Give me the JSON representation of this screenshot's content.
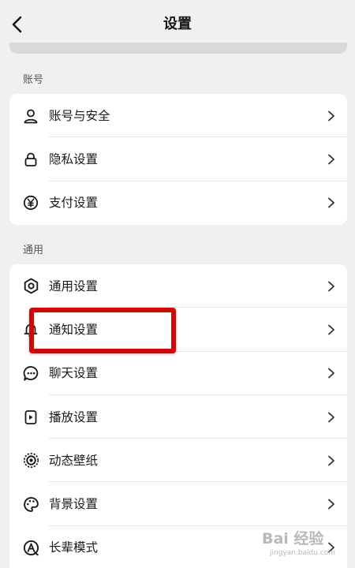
{
  "header": {
    "title": "设置"
  },
  "sections": [
    {
      "label": "账号",
      "items": [
        {
          "label": "账号与安全",
          "icon": "person-icon"
        },
        {
          "label": "隐私设置",
          "icon": "lock-icon"
        },
        {
          "label": "支付设置",
          "icon": "yen-icon"
        }
      ]
    },
    {
      "label": "通用",
      "items": [
        {
          "label": "通用设置",
          "icon": "gear-icon"
        },
        {
          "label": "通知设置",
          "icon": "bell-icon"
        },
        {
          "label": "聊天设置",
          "icon": "chat-bubble-icon"
        },
        {
          "label": "播放设置",
          "icon": "play-device-icon"
        },
        {
          "label": "动态壁纸",
          "icon": "wallpaper-icon"
        },
        {
          "label": "背景设置",
          "icon": "palette-icon"
        },
        {
          "label": "长辈模式",
          "icon": "elder-mode-icon"
        }
      ]
    }
  ],
  "highlight": {
    "color": "#cc0a0a",
    "target": "通知设置"
  },
  "watermark": {
    "main": "Bai 经验",
    "sub": "jingyan.baidu.com"
  }
}
